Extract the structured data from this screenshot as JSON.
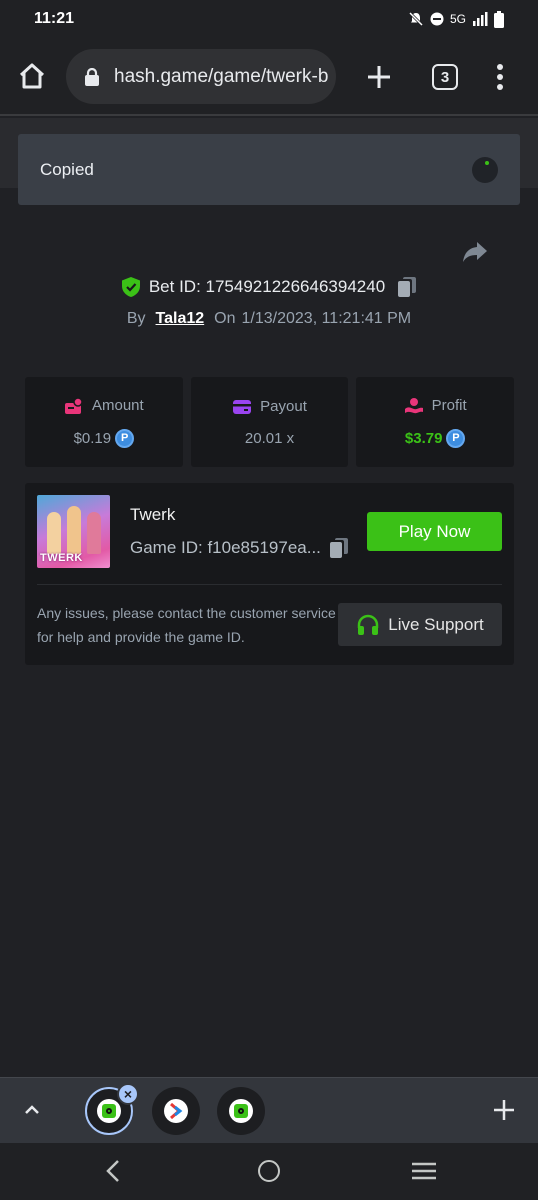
{
  "status_bar": {
    "time": "11:21",
    "network": "5G"
  },
  "browser": {
    "url": "hash.game/game/twerk-b",
    "tab_count": "3"
  },
  "toast": {
    "text": "Copied"
  },
  "bet": {
    "id_label": "Bet ID: 1754921226646394240",
    "by_label": "By",
    "user": "Tala12",
    "on_label": "On",
    "date": "1/13/2023, 11:21:41 PM"
  },
  "stats": [
    {
      "label": "Amount",
      "value": "$0.19",
      "icon": "amount-icon",
      "coin": "P"
    },
    {
      "label": "Payout",
      "value": "20.01 x",
      "icon": "wallet-icon"
    },
    {
      "label": "Profit",
      "value": "$3.79",
      "icon": "profit-icon",
      "coin": "P"
    }
  ],
  "game": {
    "name": "Twerk",
    "thumb_label": "TWERK",
    "id_label": "Game ID: f10e85197ea...",
    "play_button": "Play Now",
    "issue_text": "Any issues, please contact the customer service for help and provide the game ID.",
    "support_button": "Live Support"
  },
  "colors": {
    "accent_green": "#3bc117",
    "background": "#202125",
    "card": "#17181b",
    "coin_blue": "#3d8de0"
  }
}
